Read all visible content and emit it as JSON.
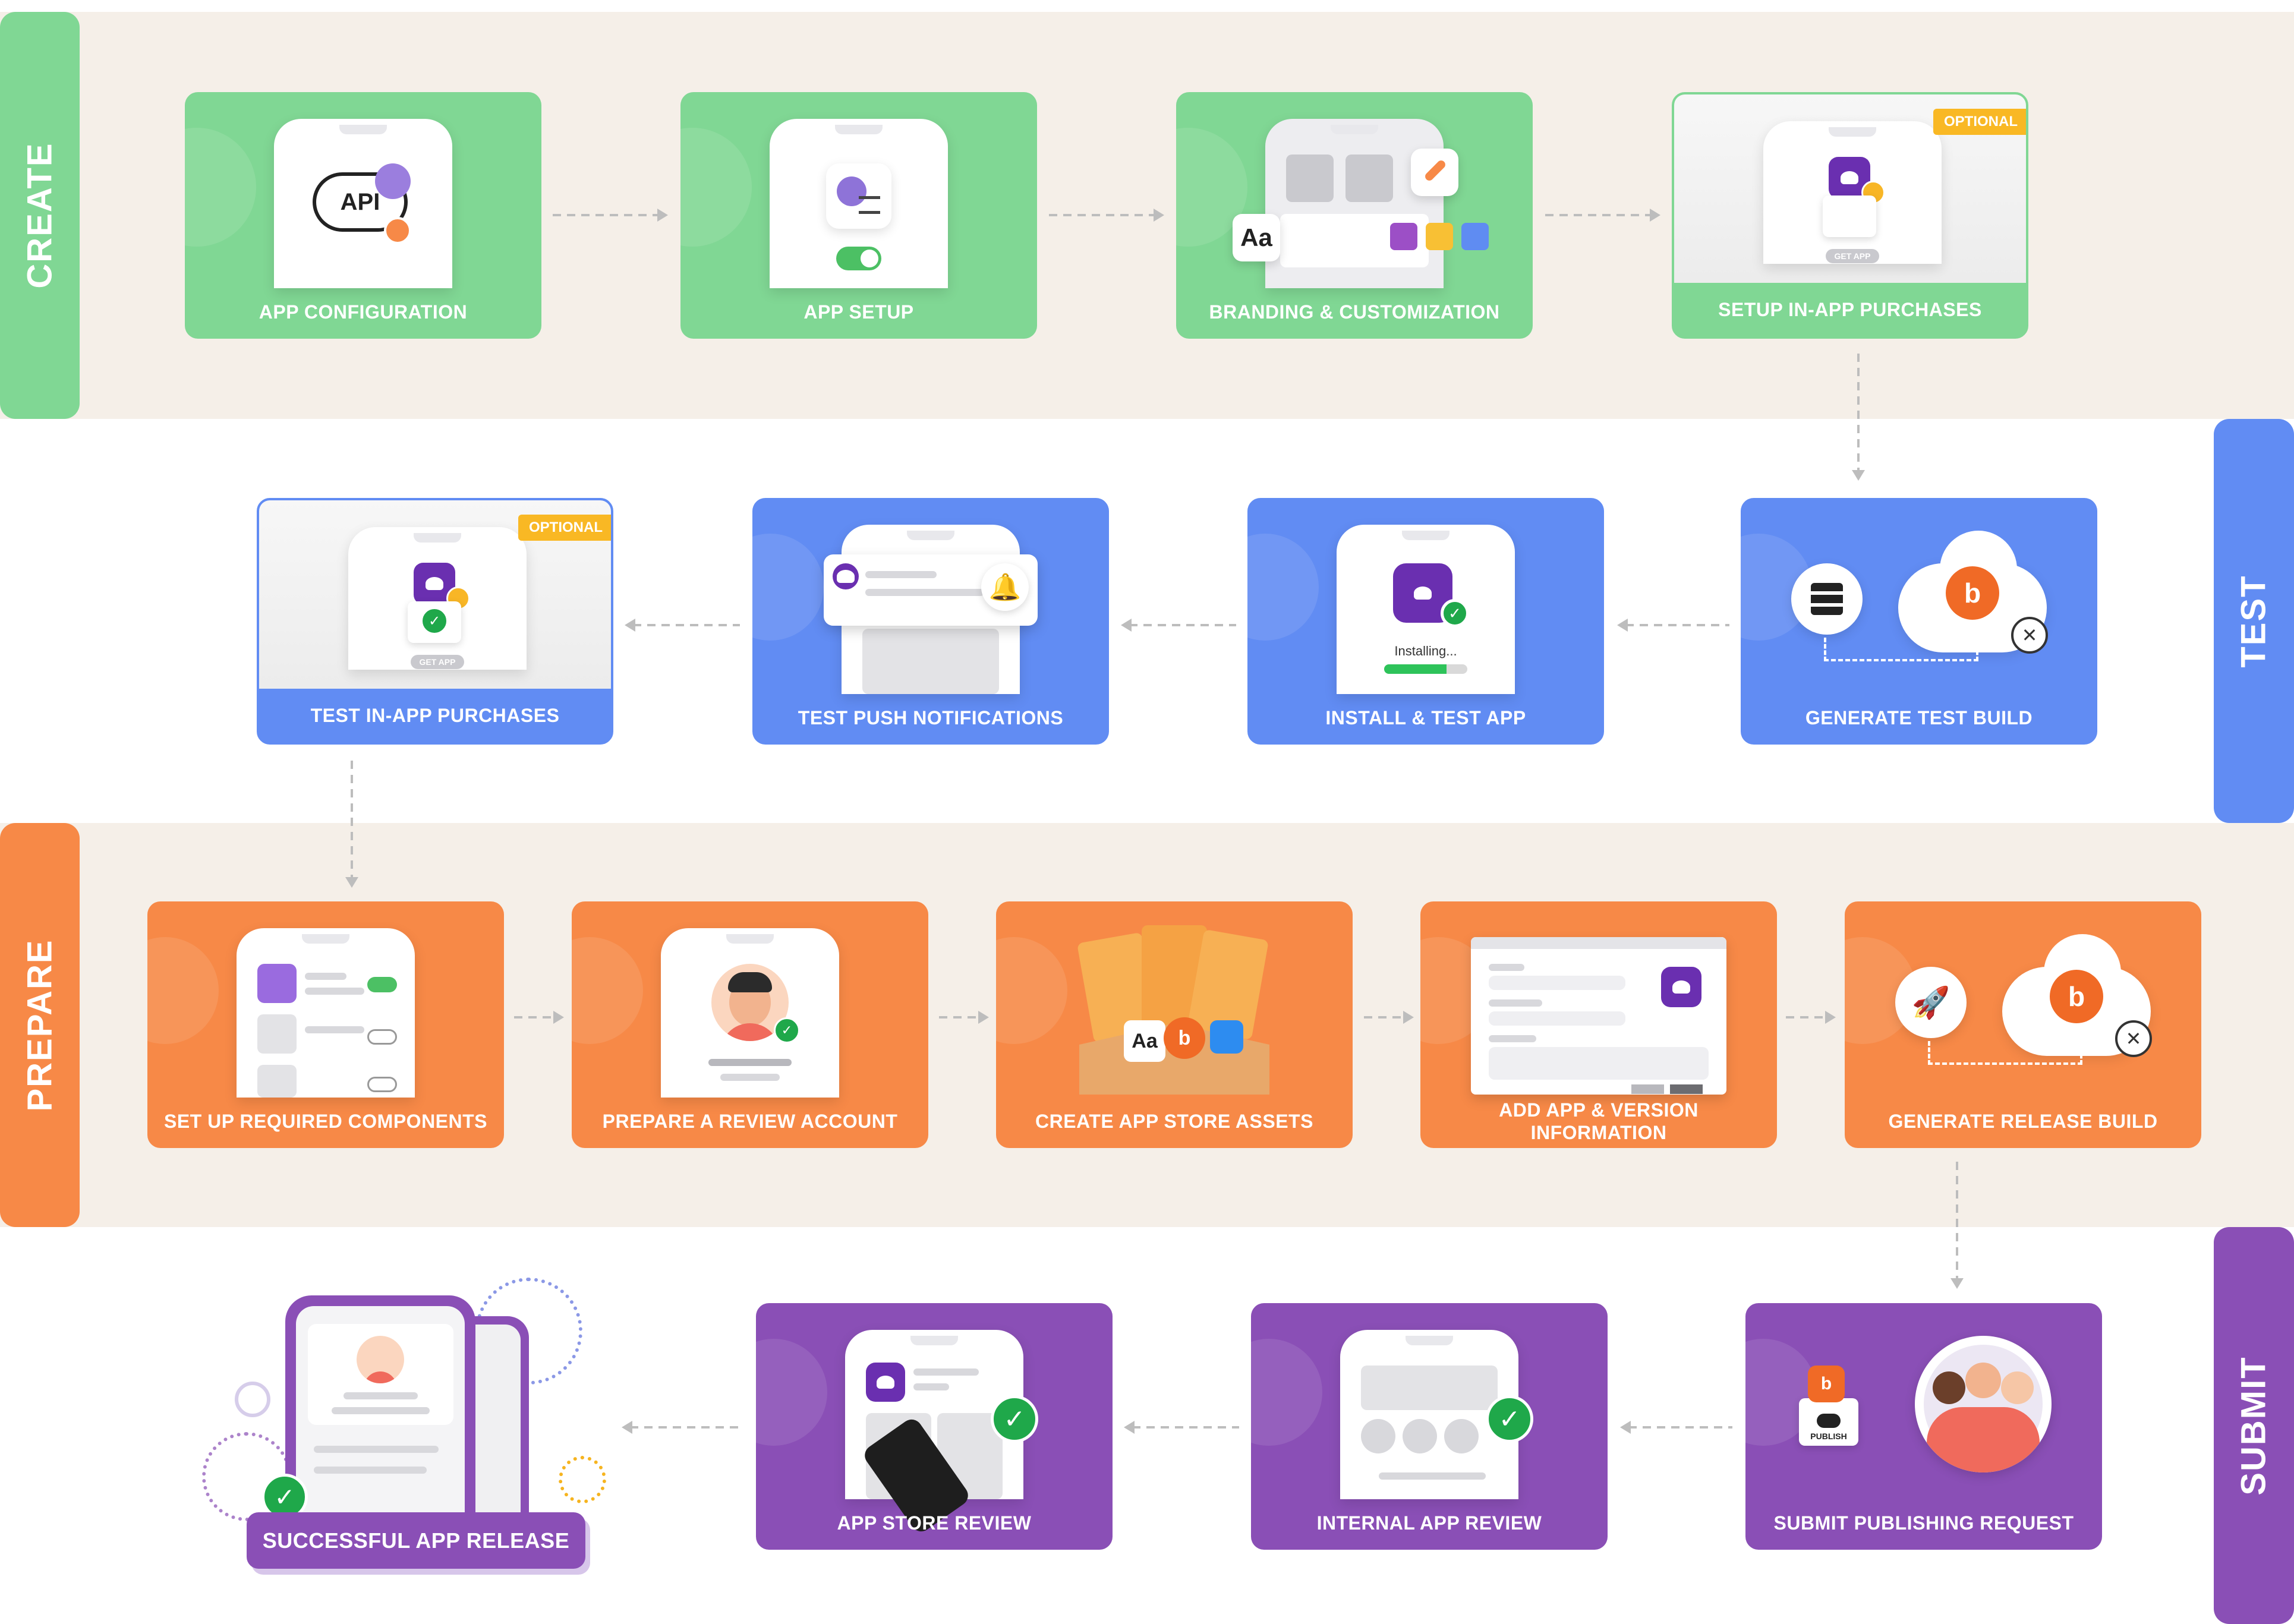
{
  "lanes": {
    "create": "CREATE",
    "test": "TEST",
    "prepare": "PREPARE",
    "submit": "SUBMIT"
  },
  "colors": {
    "create": "#80d794",
    "test": "#618cf3",
    "prepare": "#f78947",
    "submit": "#8a4fb6",
    "optional_badge": "#f9b824",
    "band": "#f5efe8"
  },
  "optional_badge": "OPTIONAL",
  "create": {
    "app_configuration": "APP CONFIGURATION",
    "api_text": "API",
    "app_setup": "APP SETUP",
    "branding": "BRANDING & CUSTOMIZATION",
    "branding_font_sample": "Aa",
    "setup_iap": "SETUP IN-APP PURCHASES",
    "get_app": "GET APP"
  },
  "test": {
    "generate_test_build": "GENERATE TEST BUILD",
    "install_test_app": "INSTALL & TEST APP",
    "installing": "Installing...",
    "test_push": "TEST PUSH NOTIFICATIONS",
    "test_iap": "TEST IN-APP PURCHASES",
    "get_app": "GET APP"
  },
  "prepare": {
    "setup_components": "SET UP REQUIRED COMPONENTS",
    "review_account": "PREPARE A REVIEW ACCOUNT",
    "store_assets": "CREATE APP STORE ASSETS",
    "store_assets_font_sample": "Aa",
    "app_version_info": "ADD APP & VERSION INFORMATION",
    "generate_release_build": "GENERATE RELEASE BUILD"
  },
  "submit": {
    "submit_request": "SUBMIT PUBLISHING REQUEST",
    "publish_label": "PUBLISH",
    "internal_review": "INTERNAL APP REVIEW",
    "store_review": "APP STORE REVIEW",
    "release": "SUCCESSFUL APP RELEASE"
  },
  "icons": {
    "api": "api-cloud-icon",
    "gear": "gear-icon",
    "toggle": "toggle-icon",
    "brush": "paintbrush-icon",
    "server": "server-icon",
    "cloud": "cloud-icon",
    "tools": "tools-icon",
    "bell": "bell-icon",
    "rocket": "rocket-icon",
    "check": "check-icon",
    "magnifier": "magnifier-icon",
    "coin": "coin-icon"
  }
}
